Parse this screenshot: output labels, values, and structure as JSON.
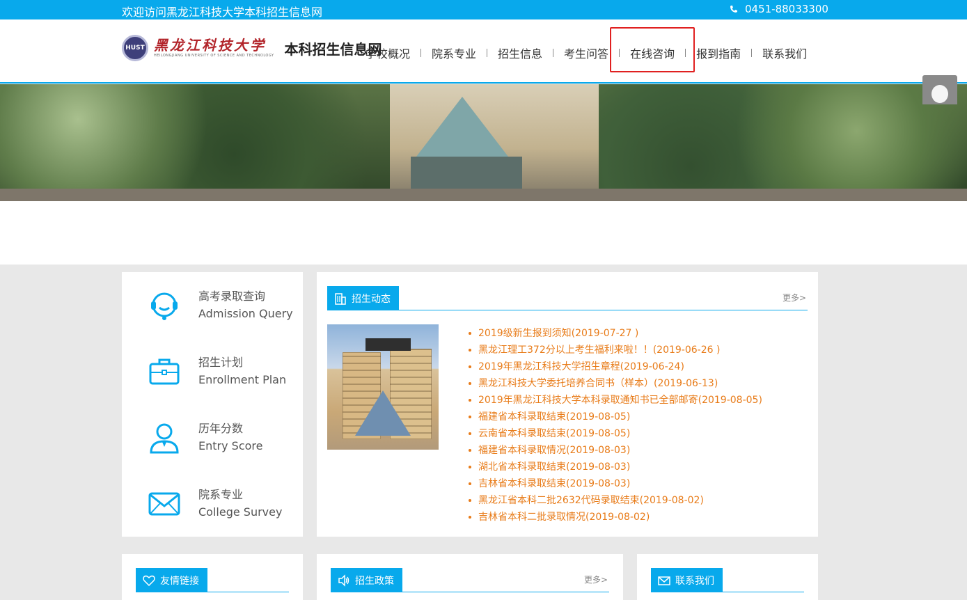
{
  "topbar": {
    "welcome": "欢迎访问黑龙江科技大学本科招生信息网",
    "phone": "0451-88033300"
  },
  "header": {
    "logo_calligraphy": "黑龙江科技大学",
    "logo_english": "HEILONGJIANG UNIVERSITY OF SCIENCE AND TECHNOLOGY",
    "site_name": "本科招生信息网"
  },
  "nav": [
    {
      "label": "学校概况"
    },
    {
      "label": "院系专业"
    },
    {
      "label": "招生信息"
    },
    {
      "label": "考生问答"
    },
    {
      "label": "在线咨询"
    },
    {
      "label": "报到指南"
    },
    {
      "label": "联系我们"
    }
  ],
  "quick_links": [
    {
      "cn": "高考录取查询",
      "en": "Admission Query",
      "icon": "headset-icon"
    },
    {
      "cn": "招生计划",
      "en": "Enrollment Plan",
      "icon": "briefcase-icon"
    },
    {
      "cn": "历年分数",
      "en": "Entry Score",
      "icon": "user-icon"
    },
    {
      "cn": "院系专业",
      "en": "College Survey",
      "icon": "mail-icon"
    }
  ],
  "news": {
    "title": "招生动态",
    "more": "更多>",
    "items": [
      "2019级新生报到须知(2019-07-27 )",
      "黑龙江理工372分以上考生福利来啦！！(2019-06-26 )",
      "2019年黑龙江科技大学招生章程(2019-06-24)",
      "黑龙江科技大学委托培养合同书（样本）(2019-06-13)",
      "2019年黑龙江科技大学本科录取通知书已全部邮寄(2019-08-05)",
      "福建省本科录取结束(2019-08-05)",
      "云南省本科录取结束(2019-08-05)",
      "福建省本科录取情况(2019-08-03)",
      "湖北省本科录取结束(2019-08-03)",
      "吉林省本科录取结束(2019-08-03)",
      "黑龙江省本科二批2632代码录取结束(2019-08-02)",
      "吉林省本科二批录取情况(2019-08-02)"
    ]
  },
  "bottom": {
    "links_title": "友情链接",
    "policy_title": "招生政策",
    "policy_more": "更多>",
    "contact_title": "联系我们"
  },
  "colors": {
    "accent": "#08a9ec",
    "news_link": "#e87b18",
    "highlight": "#e02020"
  }
}
